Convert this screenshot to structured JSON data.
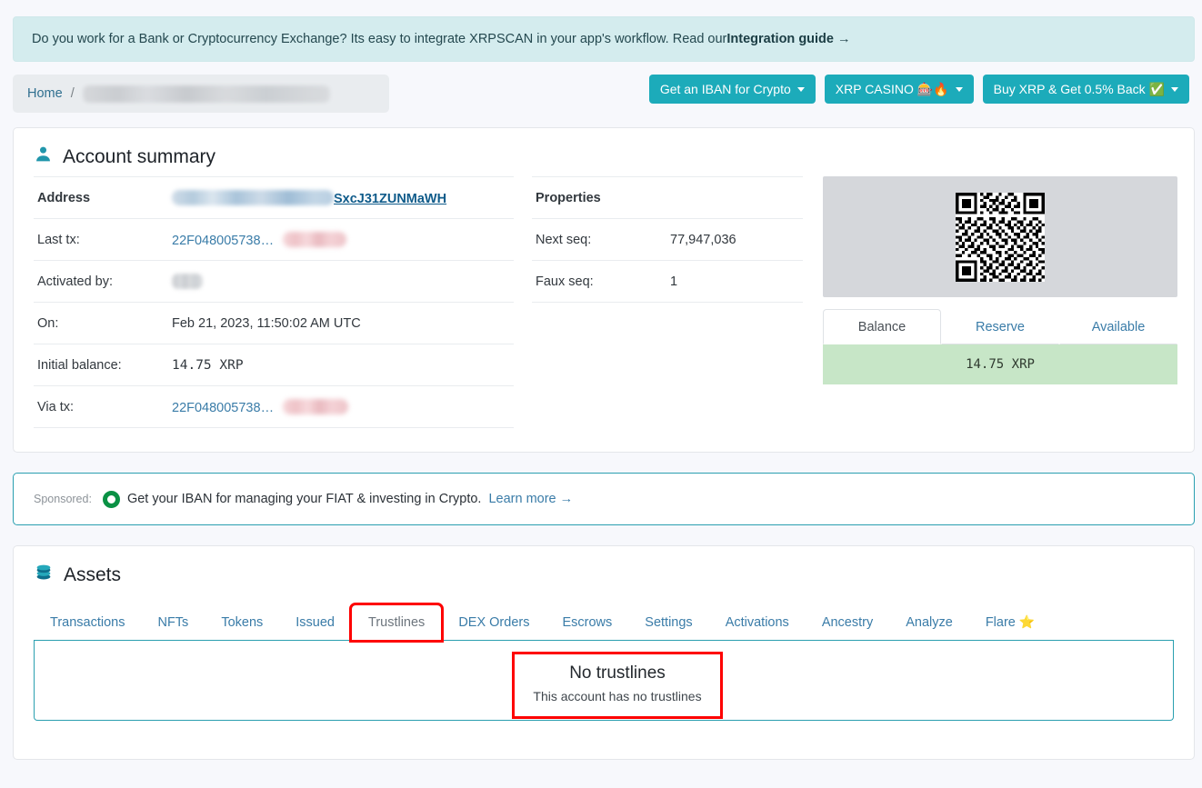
{
  "banner": {
    "text": "Do you work for a Bank or Cryptocurrency Exchange? Its easy to integrate XRPSCAN in your app's workflow. Read our ",
    "link": "Integration guide →"
  },
  "breadcrumb": {
    "home": "Home",
    "separator": "/",
    "current": "[redacted account address]"
  },
  "top_buttons": [
    {
      "label": "Get an IBAN for Crypto",
      "has_caret": true
    },
    {
      "label": "XRP CASINO 🎰🔥",
      "has_caret": true
    },
    {
      "label": "Buy XRP & Get 0.5% Back ✅",
      "has_caret": true
    }
  ],
  "account_summary": {
    "title": "Account summary",
    "icon": "person-icon",
    "rows": [
      {
        "key": "Address",
        "key_bold": true,
        "value": "SxcJ31ZUNMaWH",
        "redacted": "blue"
      },
      {
        "key": "Last tx:",
        "value": "22F048005738…",
        "redacted": "pink"
      },
      {
        "key": "Activated by:",
        "value": "",
        "redacted": "grey"
      },
      {
        "key": "On:",
        "value": "Feb 21, 2023, 11:50:02 AM UTC"
      },
      {
        "key": "Initial balance:",
        "value": "14.75  XRP"
      },
      {
        "key": "Via tx:",
        "value": "22F048005738…",
        "redacted": "pink"
      }
    ],
    "properties": {
      "header": "Properties",
      "rows": [
        {
          "key": "Next seq:",
          "value": "77,947,036"
        },
        {
          "key": "Faux seq:",
          "value": "1"
        }
      ]
    },
    "qr": {
      "alt": "qr-code"
    },
    "balance_tabs": [
      {
        "label": "Balance",
        "active": true
      },
      {
        "label": "Reserve",
        "active": false
      },
      {
        "label": "Available",
        "active": false
      }
    ],
    "balance_value": "14.75  XRP"
  },
  "sponsored": {
    "label": "Sponsored:",
    "text": "Get your IBAN for managing your FIAT & investing in Crypto.",
    "link": "Learn more →"
  },
  "assets": {
    "title": "Assets",
    "icon": "coins-icon",
    "tabs": [
      {
        "label": "Transactions",
        "active": false
      },
      {
        "label": "NFTs",
        "active": false
      },
      {
        "label": "Tokens",
        "active": false
      },
      {
        "label": "Issued",
        "active": false
      },
      {
        "label": "Trustlines",
        "active": true,
        "highlighted": true
      },
      {
        "label": "DEX Orders",
        "active": false
      },
      {
        "label": "Escrows",
        "active": false
      },
      {
        "label": "Settings",
        "active": false
      },
      {
        "label": "Activations",
        "active": false
      },
      {
        "label": "Ancestry",
        "active": false
      },
      {
        "label": "Analyze",
        "active": false
      },
      {
        "label": "Flare",
        "active": false,
        "star": "⭐"
      }
    ],
    "empty_state": {
      "title": "No trustlines",
      "subtitle": "This account has no trustlines",
      "highlighted": true
    }
  },
  "colors": {
    "accent_teal": "#1cabba",
    "banner_bg": "#d4ecee",
    "balance_green": "#c7e6c7",
    "highlight_red": "#fe0000",
    "link_blue": "#3a7ca8"
  }
}
